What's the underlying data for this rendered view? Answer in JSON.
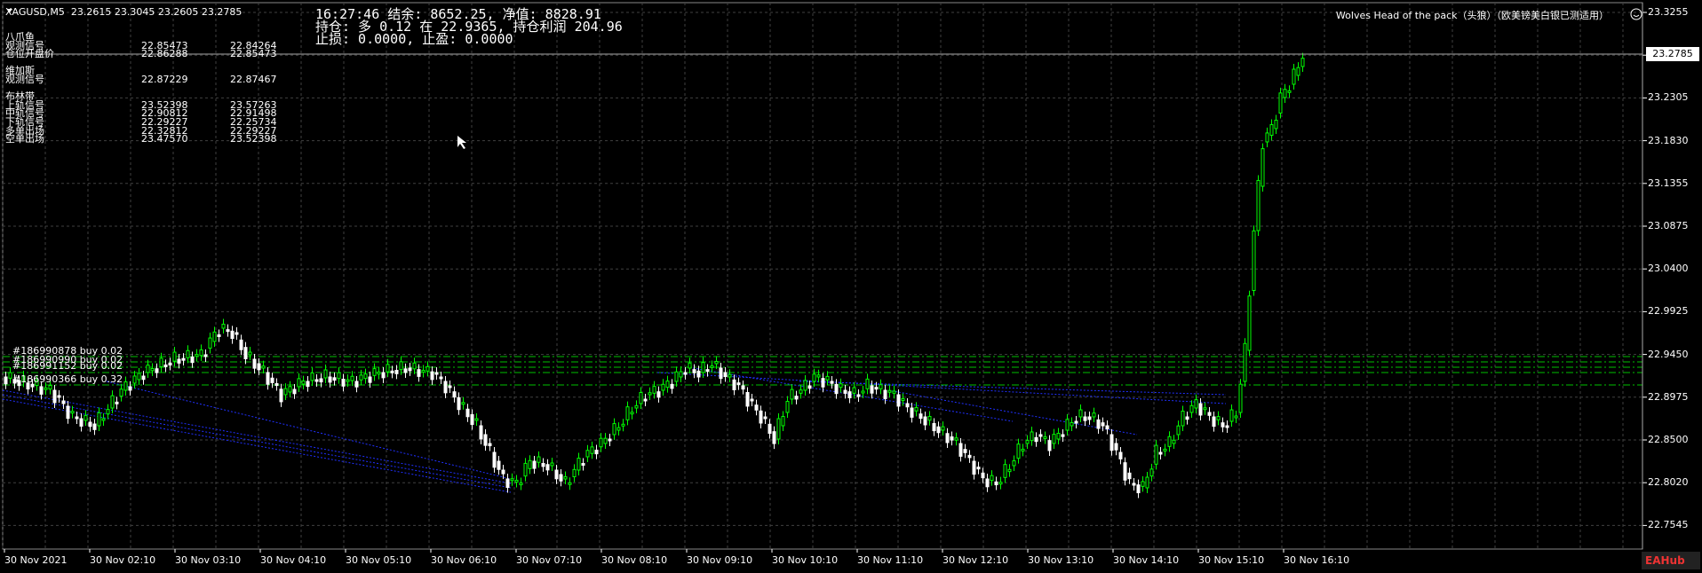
{
  "window": {
    "symbol_line": "XAGUSD,M5  23.2615 23.3045 23.2605 23.2785",
    "ea_name": "Wolves Head of the pack（头狼）（欧美镑美白银已测适用）"
  },
  "account_info": {
    "line1": "16:27:46 结余: 8652.25, 净值: 8828.91",
    "line2": "持仓: 多 0.12 在 22.9365, 持仓利润 204.96",
    "line3": "止损: 0.0000, 止盈: 0.0000"
  },
  "indicator_panel": [
    {
      "label": "八爪鱼",
      "v1": "",
      "v2": ""
    },
    {
      "label": "观测信号",
      "v1": "22.85473",
      "v2": "22.84264"
    },
    {
      "label": "仓位开盘价",
      "v1": "22.86288",
      "v2": "22.85473"
    },
    {
      "label": "",
      "v1": "",
      "v2": ""
    },
    {
      "label": "维加斯",
      "v1": "",
      "v2": ""
    },
    {
      "label": "观测信号",
      "v1": "22.87229",
      "v2": "22.87467"
    },
    {
      "label": "",
      "v1": "",
      "v2": ""
    },
    {
      "label": "布林带",
      "v1": "",
      "v2": ""
    },
    {
      "label": "上轨信号",
      "v1": "23.52398",
      "v2": "23.57263"
    },
    {
      "label": "中轨信号",
      "v1": "22.90812",
      "v2": "22.91498"
    },
    {
      "label": "下轨信号",
      "v1": "22.29227",
      "v2": "22.25734"
    },
    {
      "label": "多单出场",
      "v1": "22.32812",
      "v2": "22.29227"
    },
    {
      "label": "空单出场",
      "v1": "23.47570",
      "v2": "23.52398"
    }
  ],
  "orders": [
    {
      "text": "#186990878 buy 0.02"
    },
    {
      "text": "#186990990 buy 0.02"
    },
    {
      "text": "#186991152 buy 0.02"
    },
    {
      "text": "#186990366 buy 0.32"
    }
  ],
  "price_axis": [
    "23.3255",
    "23.2785",
    "23.2305",
    "23.1830",
    "23.1355",
    "23.0875",
    "23.0400",
    "22.9925",
    "22.9450",
    "22.8975",
    "22.8500",
    "22.8020",
    "22.7545"
  ],
  "current_price": "23.2785",
  "time_axis": [
    "30 Nov 2021",
    "30 Nov 02:10",
    "30 Nov 03:10",
    "30 Nov 04:10",
    "30 Nov 05:10",
    "30 Nov 06:10",
    "30 Nov 07:10",
    "30 Nov 08:10",
    "30 Nov 09:10",
    "30 Nov 10:10",
    "30 Nov 11:10",
    "30 Nov 12:10",
    "30 Nov 13:10",
    "30 Nov 14:10",
    "30 Nov 15:10",
    "30 Nov 16:10"
  ],
  "watermark": "EAHub",
  "colors": {
    "bull": "#00ff00",
    "bear": "#ffffff",
    "grid": "#404040",
    "level": "#00c000",
    "order_line": "#2030ff"
  }
}
